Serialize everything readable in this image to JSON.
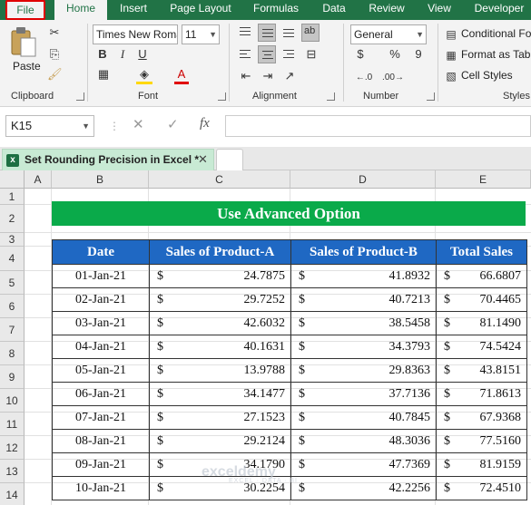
{
  "ribbon_tabs": [
    "File",
    "Home",
    "Insert",
    "Page Layout",
    "Formulas",
    "Data",
    "Review",
    "View",
    "Developer"
  ],
  "clipboard": {
    "paste_label": "Paste",
    "group_label": "Clipboard"
  },
  "font": {
    "font_name": "Times New Roman",
    "font_size": "11",
    "bold": "B",
    "italic": "I",
    "underline": "U",
    "font_color_glyph": "A",
    "group_label": "Font"
  },
  "alignment": {
    "wrap_glyph": "ab",
    "group_label": "Alignment"
  },
  "number": {
    "format": "General",
    "currency_glyph": "$",
    "percent_glyph": "%",
    "comma_glyph": "9",
    "group_label": "Number"
  },
  "styles": {
    "conditional_formatting": "Conditional Formatting",
    "format_as_table": "Format as Table",
    "cell_styles": "Cell Styles",
    "group_label": "Styles"
  },
  "formula_bar": {
    "name_box": "K15",
    "fx": "fx",
    "value": ""
  },
  "workbook": {
    "tab_title": "Set Rounding Precision in Excel *"
  },
  "grid": {
    "columns": [
      "A",
      "B",
      "C",
      "D",
      "E"
    ],
    "rows": [
      "1",
      "2",
      "3",
      "4",
      "5",
      "6",
      "7",
      "8",
      "9",
      "10",
      "11",
      "12",
      "13",
      "14"
    ]
  },
  "sheet": {
    "banner": "Use Advanced Option",
    "headers": [
      "Date",
      "Sales of Product-A",
      "Sales of Product-B",
      "Total Sales"
    ],
    "currency": "$",
    "rows": [
      {
        "date": "01-Jan-21",
        "a": "24.7875",
        "b": "41.8932",
        "total": "66.6807"
      },
      {
        "date": "02-Jan-21",
        "a": "29.7252",
        "b": "40.7213",
        "total": "70.4465"
      },
      {
        "date": "03-Jan-21",
        "a": "42.6032",
        "b": "38.5458",
        "total": "81.1490"
      },
      {
        "date": "04-Jan-21",
        "a": "40.1631",
        "b": "34.3793",
        "total": "74.5424"
      },
      {
        "date": "05-Jan-21",
        "a": "13.9788",
        "b": "29.8363",
        "total": "43.8151"
      },
      {
        "date": "06-Jan-21",
        "a": "34.1477",
        "b": "37.7136",
        "total": "71.8613"
      },
      {
        "date": "07-Jan-21",
        "a": "27.1523",
        "b": "40.7845",
        "total": "67.9368"
      },
      {
        "date": "08-Jan-21",
        "a": "29.2124",
        "b": "48.3036",
        "total": "77.5160"
      },
      {
        "date": "09-Jan-21",
        "a": "34.1790",
        "b": "47.7369",
        "total": "81.9159"
      },
      {
        "date": "10-Jan-21",
        "a": "30.2254",
        "b": "42.2256",
        "total": "72.4510"
      }
    ]
  },
  "watermark": {
    "brand": "exceldemy",
    "tagline": "EXCEL · DATA · BI"
  },
  "colors": {
    "ribbon_green": "#217346",
    "banner_green": "#0aaa4a",
    "header_blue": "#1f68c3",
    "file_highlight": "#e00000"
  }
}
